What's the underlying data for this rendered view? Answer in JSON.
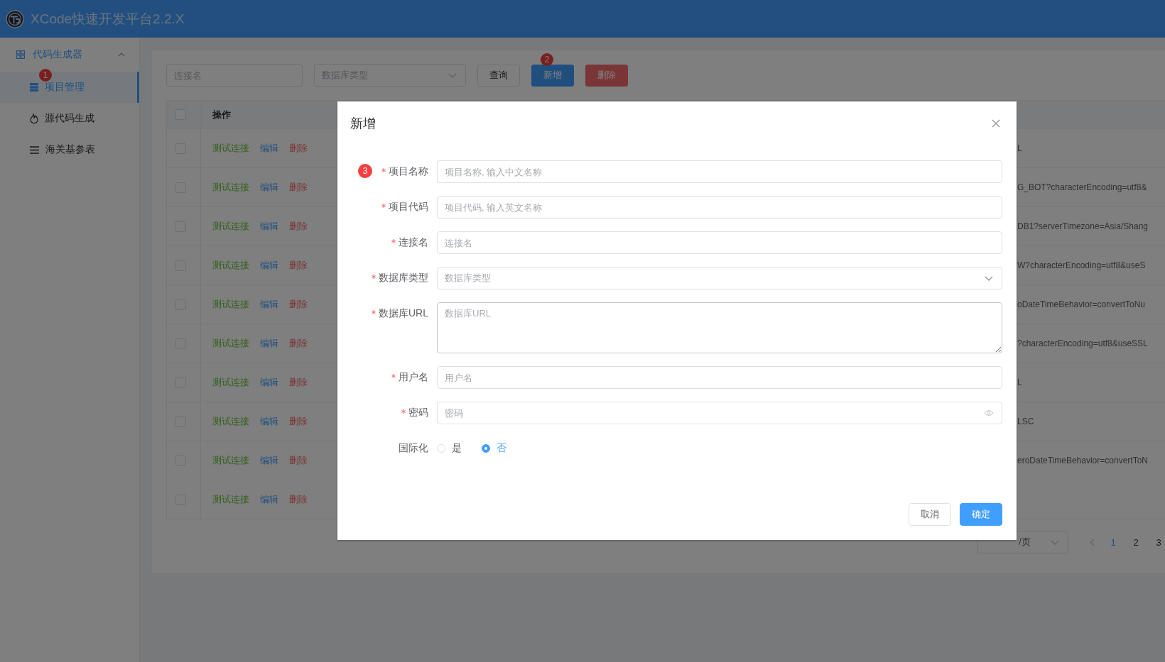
{
  "header": {
    "title": "XCode快速开发平台2.2.X"
  },
  "sidebar": {
    "group": {
      "label": "代码生成器",
      "expanded": true
    },
    "items": [
      {
        "label": "项目管理",
        "kind": "table",
        "selected": true,
        "badge": "1"
      },
      {
        "label": "源代码生成",
        "kind": "fire",
        "selected": false
      },
      {
        "label": "海关基参表",
        "kind": "list",
        "selected": false
      }
    ]
  },
  "toolbar": {
    "search": {
      "placeholder": "连接名"
    },
    "type_select": {
      "placeholder": "数据库类型"
    },
    "buttons": [
      {
        "label": "查询",
        "kind": "default"
      },
      {
        "label": "新增",
        "kind": "primary",
        "badge": "2"
      },
      {
        "label": "删除",
        "kind": "danger"
      }
    ]
  },
  "table": {
    "header_checked": false,
    "columns": [
      {
        "label": "操作"
      }
    ],
    "rows": [
      {
        "checked": false,
        "actions": [
          {
            "label": "测试连接",
            "kind": "test"
          },
          {
            "label": "编辑",
            "kind": "edit"
          },
          {
            "label": "删除",
            "kind": "delete"
          }
        ],
        "url": "L"
      },
      {
        "checked": false,
        "actions": [
          {
            "label": "测试连接",
            "kind": "test"
          },
          {
            "label": "编辑",
            "kind": "edit"
          },
          {
            "label": "删除",
            "kind": "delete"
          }
        ],
        "url": "G_BOT?characterEncoding=utf8&"
      },
      {
        "checked": false,
        "actions": [
          {
            "label": "测试连接",
            "kind": "test"
          },
          {
            "label": "编辑",
            "kind": "edit"
          },
          {
            "label": "删除",
            "kind": "delete"
          }
        ],
        "url": "DB1?serverTimezone=Asia/Shang"
      },
      {
        "checked": false,
        "actions": [
          {
            "label": "测试连接",
            "kind": "test"
          },
          {
            "label": "编辑",
            "kind": "edit"
          },
          {
            "label": "删除",
            "kind": "delete"
          }
        ],
        "url": "W?characterEncoding=utf8&useS"
      },
      {
        "checked": false,
        "actions": [
          {
            "label": "测试连接",
            "kind": "test"
          },
          {
            "label": "编辑",
            "kind": "edit"
          },
          {
            "label": "删除",
            "kind": "delete"
          }
        ],
        "url": "oDateTimeBehavior=convertToNu"
      },
      {
        "checked": false,
        "actions": [
          {
            "label": "测试连接",
            "kind": "test"
          },
          {
            "label": "编辑",
            "kind": "edit"
          },
          {
            "label": "删除",
            "kind": "delete"
          }
        ],
        "url": "?characterEncoding=utf8&useSSL"
      },
      {
        "checked": false,
        "actions": [
          {
            "label": "测试连接",
            "kind": "test"
          },
          {
            "label": "编辑",
            "kind": "edit"
          },
          {
            "label": "删除",
            "kind": "delete"
          }
        ],
        "url": "L"
      },
      {
        "checked": false,
        "actions": [
          {
            "label": "测试连接",
            "kind": "test"
          },
          {
            "label": "编辑",
            "kind": "edit"
          },
          {
            "label": "删除",
            "kind": "delete"
          }
        ],
        "url": "LSC"
      },
      {
        "checked": false,
        "actions": [
          {
            "label": "测试连接",
            "kind": "test"
          },
          {
            "label": "编辑",
            "kind": "edit"
          },
          {
            "label": "删除",
            "kind": "delete"
          }
        ],
        "url": "eroDateTimeBehavior=convertToN"
      },
      {
        "checked": false,
        "actions": [
          {
            "label": "测试连接",
            "kind": "test"
          },
          {
            "label": "编辑",
            "kind": "edit"
          },
          {
            "label": "删除",
            "kind": "delete"
          }
        ]
      }
    ]
  },
  "pagination": {
    "page_size": "/页",
    "pages": [
      {
        "label": "1",
        "selected": true
      },
      {
        "label": "2",
        "selected": false
      },
      {
        "label": "3",
        "selected": false
      }
    ]
  },
  "dialog": {
    "title": "新增",
    "fields": [
      {
        "kind": "input",
        "label": "项目名称",
        "required": true,
        "placeholder": "项目名称, 输入中文名称",
        "badge": "3"
      },
      {
        "kind": "input",
        "label": "项目代码",
        "required": true,
        "placeholder": "项目代码, 输入英文名称"
      },
      {
        "kind": "input",
        "label": "连接名",
        "required": true,
        "placeholder": "连接名"
      },
      {
        "kind": "select",
        "label": "数据库类型",
        "required": true,
        "placeholder": "数据库类型"
      },
      {
        "kind": "textarea",
        "label": "数据库URL",
        "required": true,
        "placeholder": "数据库URL"
      },
      {
        "kind": "input",
        "label": "用户名",
        "required": true,
        "placeholder": "用户名"
      },
      {
        "kind": "password",
        "label": "密码",
        "required": true,
        "placeholder": "密码"
      },
      {
        "kind": "radio",
        "label": "国际化",
        "required": false,
        "options": [
          {
            "label": "是",
            "selected": false
          },
          {
            "label": "否",
            "selected": true
          }
        ]
      }
    ],
    "buttons": [
      {
        "label": "取消",
        "kind": "default"
      },
      {
        "label": "确定",
        "kind": "primary"
      }
    ]
  }
}
